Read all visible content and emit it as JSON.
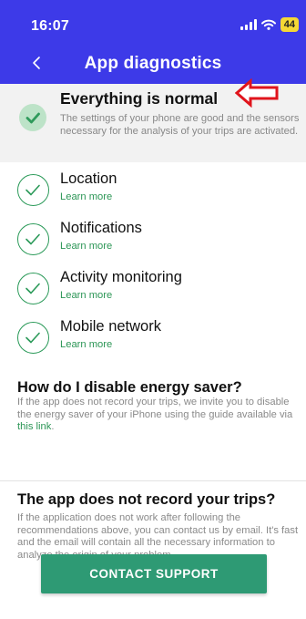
{
  "status_bar": {
    "time": "16:07",
    "battery": "44"
  },
  "nav": {
    "title": "App diagnostics"
  },
  "summary": {
    "title": "Everything is normal",
    "text": "The settings of your phone are good and the sensors necessary for the analysis of your trips are activated."
  },
  "checks": [
    {
      "title": "Location",
      "link": "Learn more"
    },
    {
      "title": "Notifications",
      "link": "Learn more"
    },
    {
      "title": "Activity monitoring",
      "link": "Learn more"
    },
    {
      "title": "Mobile network",
      "link": "Learn more"
    }
  ],
  "energy": {
    "title": "How do I disable energy saver?",
    "text": "If the app does not record your trips, we invite you to disable the energy saver of your iPhone using the guide available via ",
    "link": "this link",
    "end": "."
  },
  "trips": {
    "title": "The app does not record your trips?",
    "text": "If the application does not work after following the recommendations above, you can contact us by email. It's fast and the email will contain all the necessary information to analyze the origin of your problem."
  },
  "contact_button": "CONTACT SUPPORT",
  "colors": {
    "header": "#3d3ae8",
    "accent_green": "#2c9656",
    "button": "#2e9a74",
    "annotation_arrow": "#e0141c"
  }
}
